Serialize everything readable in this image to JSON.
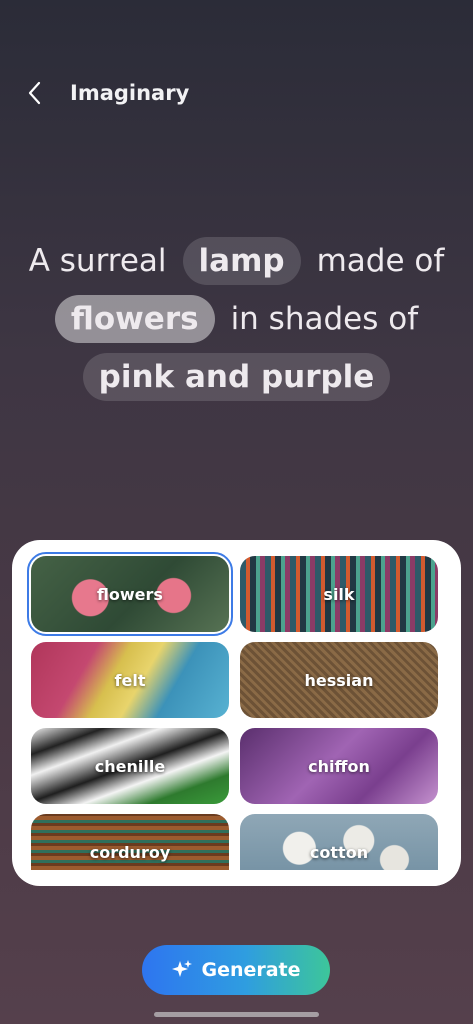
{
  "header": {
    "title": "Imaginary"
  },
  "prompt": {
    "line1": {
      "pre": "A surreal",
      "chip": "lamp",
      "post": "made of"
    },
    "line2": {
      "chip": "flowers",
      "post": "in shades of"
    },
    "line3": {
      "chip": "pink and purple"
    }
  },
  "materials": [
    {
      "label": "flowers",
      "selected": true
    },
    {
      "label": "silk"
    },
    {
      "label": "felt"
    },
    {
      "label": "hessian"
    },
    {
      "label": "chenille"
    },
    {
      "label": "chiffon"
    },
    {
      "label": "corduroy"
    },
    {
      "label": "cotton"
    }
  ],
  "generate": {
    "label": "Generate"
  },
  "colors": {
    "accent": "#3d7be6",
    "button_start": "#2e75f0",
    "button_end": "#3dc69a"
  }
}
